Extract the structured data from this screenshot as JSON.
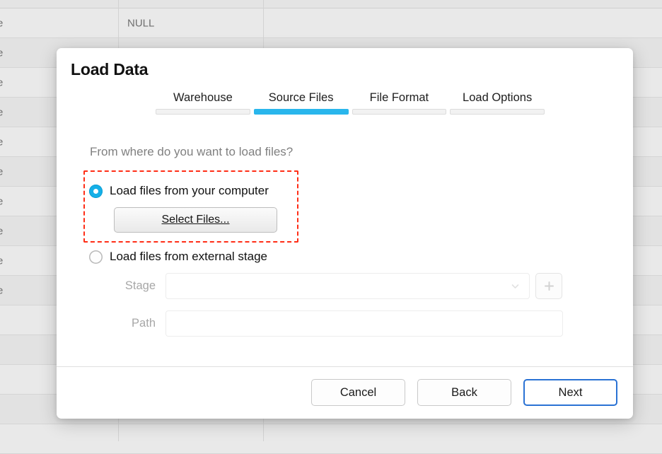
{
  "background": {
    "rows": [
      {
        "c0": "e",
        "c1": "NULL"
      },
      {
        "c0": "e",
        "c1": ""
      },
      {
        "c0": "e",
        "c1": ""
      },
      {
        "c0": "e",
        "c1": ""
      },
      {
        "c0": "e",
        "c1": ""
      },
      {
        "c0": "e",
        "c1": ""
      },
      {
        "c0": "e",
        "c1": ""
      },
      {
        "c0": "e",
        "c1": ""
      },
      {
        "c0": "e",
        "c1": ""
      },
      {
        "c0": "e",
        "c1": ""
      },
      {
        "c0": "",
        "c1": ""
      },
      {
        "c0": "",
        "c1": ""
      },
      {
        "c0": "",
        "c1": ""
      },
      {
        "c0": "",
        "c1": ""
      },
      {
        "c0": "",
        "c1": ""
      }
    ]
  },
  "dialog": {
    "title": "Load Data",
    "question": "From where do you want to load files?",
    "tabs": [
      {
        "label": "Warehouse",
        "active": false
      },
      {
        "label": "Source Files",
        "active": true
      },
      {
        "label": "File Format",
        "active": false
      },
      {
        "label": "Load Options",
        "active": false
      }
    ],
    "options": {
      "computer": {
        "label": "Load files from your computer",
        "selected": true,
        "button_label": "Select Files..."
      },
      "external_stage": {
        "label": "Load files from external stage",
        "selected": false
      }
    },
    "fields": [
      {
        "label": "Stage",
        "value": "",
        "placeholder": "",
        "disabled": true
      },
      {
        "label": "Path",
        "value": "",
        "placeholder": "",
        "disabled": true
      }
    ],
    "add_stage_icon": "plus-icon",
    "stage_dropdown_icon": "chevron-down-icon",
    "footer": {
      "cancel_label": "Cancel",
      "back_label": "Back",
      "next_label": "Next"
    }
  },
  "annotation": {
    "color": "#ff2d16",
    "style": "dashed-rectangle"
  },
  "colors": {
    "accent": "#29b6ec",
    "radio_selected": "#15b0e8",
    "focus_ring": "#2a72d4",
    "annotation": "#ff2d16"
  }
}
